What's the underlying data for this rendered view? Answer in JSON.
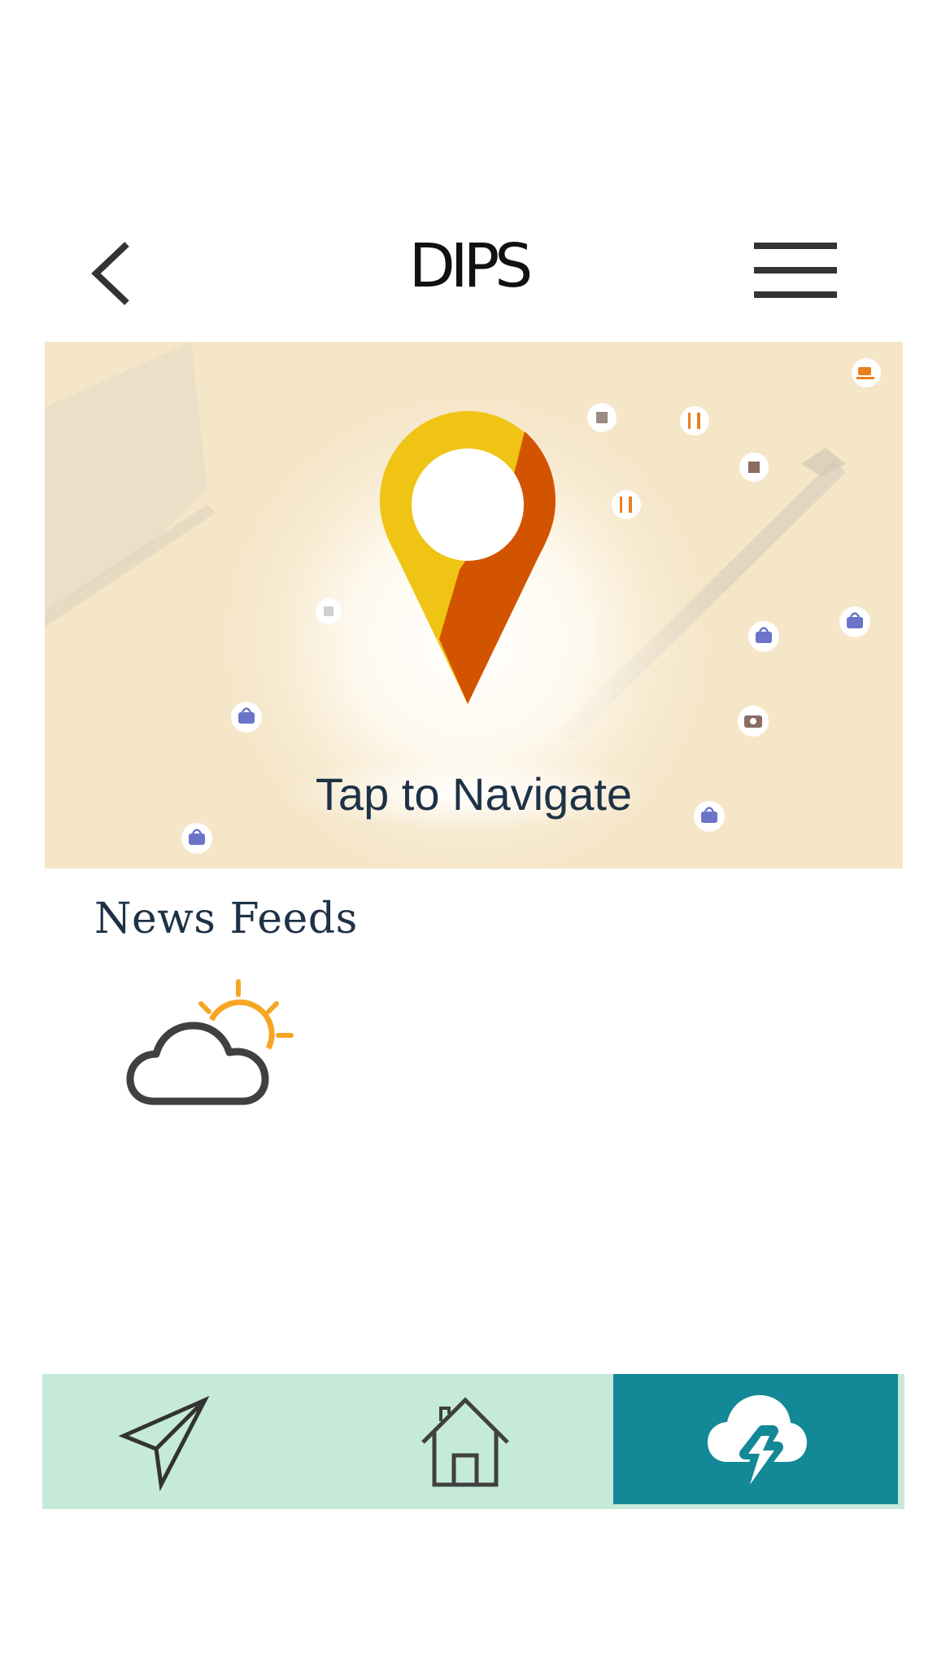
{
  "header": {
    "title": "DIPS",
    "back_icon": "chevron-left-icon",
    "menu_icon": "hamburger-menu-icon"
  },
  "map_banner": {
    "label": "Tap to Navigate",
    "pin_icon": "location-pin-icon",
    "colors": {
      "background": "#f5e6c8",
      "pin_yellow": "#f0c414",
      "pin_orange": "#d35400"
    }
  },
  "news": {
    "title": "News Feeds",
    "weather_icon": "partly-cloudy-icon"
  },
  "bottom_nav": {
    "items": [
      {
        "icon": "paper-plane-icon",
        "active": false
      },
      {
        "icon": "home-icon",
        "active": false
      },
      {
        "icon": "cloud-lightning-icon",
        "active": true
      }
    ],
    "colors": {
      "bar": "#c5ebd8",
      "active": "#138896"
    }
  }
}
